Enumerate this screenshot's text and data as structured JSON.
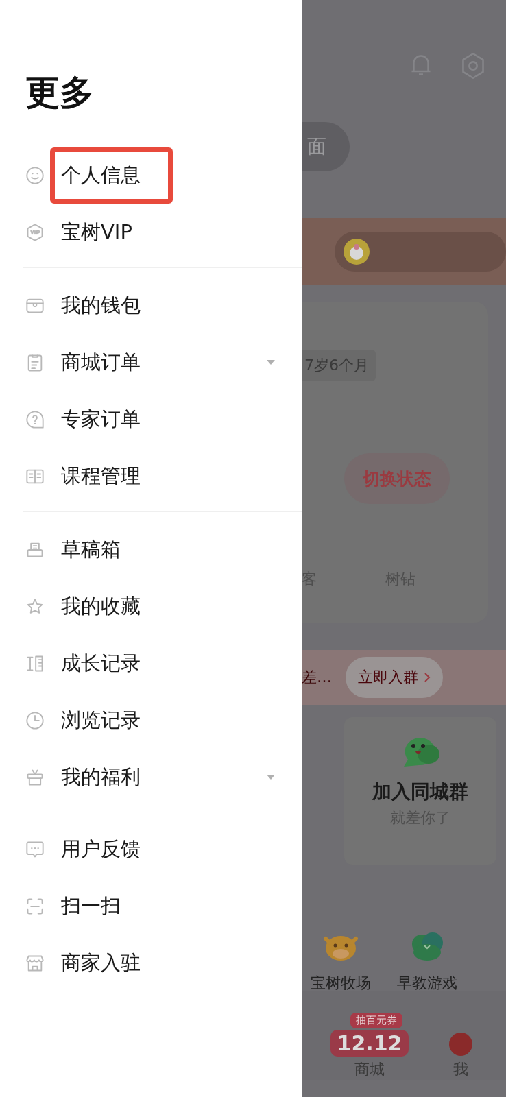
{
  "drawer": {
    "title": "更多",
    "groups": [
      {
        "divider_above": false,
        "items": [
          {
            "label": "个人信息",
            "highlighted": true,
            "has_submenu": false
          },
          {
            "label": "宝树VIP",
            "highlighted": false,
            "has_submenu": false
          }
        ]
      },
      {
        "divider_above": true,
        "items": [
          {
            "label": "我的钱包",
            "highlighted": false,
            "has_submenu": false
          },
          {
            "label": "商城订单",
            "highlighted": false,
            "has_submenu": true
          },
          {
            "label": "专家订单",
            "highlighted": false,
            "has_submenu": false
          },
          {
            "label": "课程管理",
            "highlighted": false,
            "has_submenu": false
          }
        ]
      },
      {
        "divider_above": true,
        "items": [
          {
            "label": "草稿箱",
            "highlighted": false,
            "has_submenu": false
          },
          {
            "label": "我的收藏",
            "highlighted": false,
            "has_submenu": false
          },
          {
            "label": "成长记录",
            "highlighted": false,
            "has_submenu": false
          },
          {
            "label": "浏览记录",
            "highlighted": false,
            "has_submenu": false
          },
          {
            "label": "我的福利",
            "highlighted": false,
            "has_submenu": true
          }
        ]
      },
      {
        "divider_above": false,
        "items": [
          {
            "label": "用户反馈",
            "highlighted": false,
            "has_submenu": false
          },
          {
            "label": "扫一扫",
            "highlighted": false,
            "has_submenu": false
          },
          {
            "label": "商家入驻",
            "highlighted": false,
            "has_submenu": false
          }
        ]
      }
    ]
  },
  "background_page": {
    "cover_button": "面",
    "age_tag": "7岁6个月",
    "switch_button": "切换状态",
    "stats": [
      "客",
      "树钻"
    ],
    "banner": {
      "text": "差…",
      "button": "立即入群"
    },
    "group_card": {
      "title": "加入同城群",
      "subtitle": "就差你了"
    },
    "shortcuts": [
      {
        "label": "宝树牧场"
      },
      {
        "label": "早教游戏"
      }
    ],
    "tab_bar": {
      "promo_tag": "抽百元券",
      "logo": "12.12",
      "mall_label": "商城",
      "me_label": "我"
    }
  }
}
